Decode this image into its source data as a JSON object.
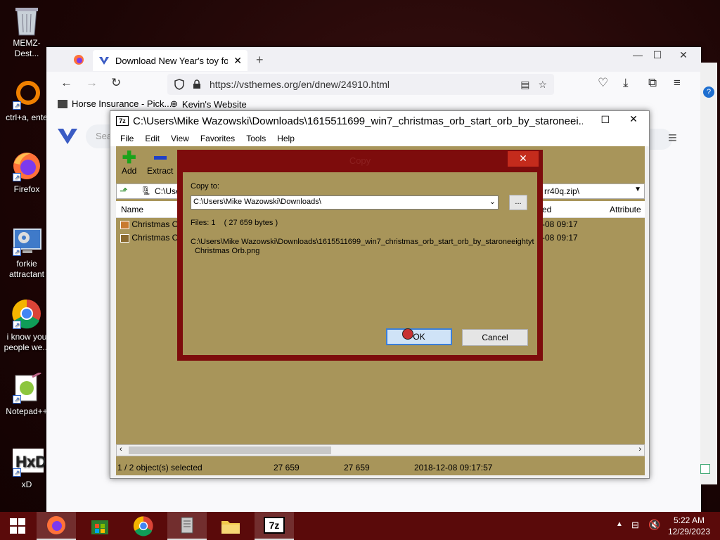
{
  "desktop": {
    "icons": [
      {
        "label": "MEMZ-Dest..."
      },
      {
        "label": "ctrl+a, ente"
      },
      {
        "label": "Firefox"
      },
      {
        "label": "forkie attractant"
      },
      {
        "label": "i know you people we..."
      },
      {
        "label": "Notepad++"
      },
      {
        "label": "xD"
      }
    ]
  },
  "browser": {
    "tab_title": "Download New Year's toy for the",
    "url": "https://vsthemes.org/en/dnew/24910.html",
    "url_host": "vsthemes.org",
    "bookmarks": [
      "Horse Insurance - Pick...",
      "Kevin's Website"
    ],
    "site_search_placeholder": "Sea"
  },
  "zip": {
    "title": "C:\\Users\\Mike Wazowski\\Downloads\\1615511699_win7_christmas_orb_start_orb_by_staroneei...",
    "menu": [
      "File",
      "Edit",
      "View",
      "Favorites",
      "Tools",
      "Help"
    ],
    "toolbar": {
      "add": "Add",
      "extract": "Extract"
    },
    "path_left": "C:\\Use",
    "path_right": "rr40q.zip\\",
    "columns": {
      "name": "Name",
      "modified": "ed",
      "attributes": "Attribute"
    },
    "rows": [
      {
        "name": "Christmas O",
        "modified": "-08 09:17"
      },
      {
        "name": "Christmas O",
        "modified": "-08 09:17"
      }
    ],
    "status": {
      "selected": "1 / 2 object(s) selected",
      "size": "27 659",
      "packed": "27 659",
      "date": "2018-12-08 09:17:57"
    }
  },
  "dialog": {
    "title": "Copy",
    "copy_to_label": "Copy to:",
    "destination": "C:\\Users\\Mike Wazowski\\Downloads\\",
    "browse_label": "...",
    "files_info": "Files: 1    ( 27 659 bytes )",
    "source_line1": "C:\\Users\\Mike Wazowski\\Downloads\\1615511699_win7_christmas_orb_start_orb_by_staroneeightyt",
    "source_line2": "Christmas Orb.png",
    "ok_label": "OK",
    "cancel_label": "Cancel"
  },
  "taskbar": {
    "time": "5:22 AM",
    "date": "12/29/2023"
  },
  "colors": {
    "desktop_bg": "#1c0505",
    "dialog_border": "#7d0c0c",
    "panel_bg": "#a8955a",
    "taskbar_bg": "#5a0a0a",
    "close_red": "#c42b1c"
  }
}
